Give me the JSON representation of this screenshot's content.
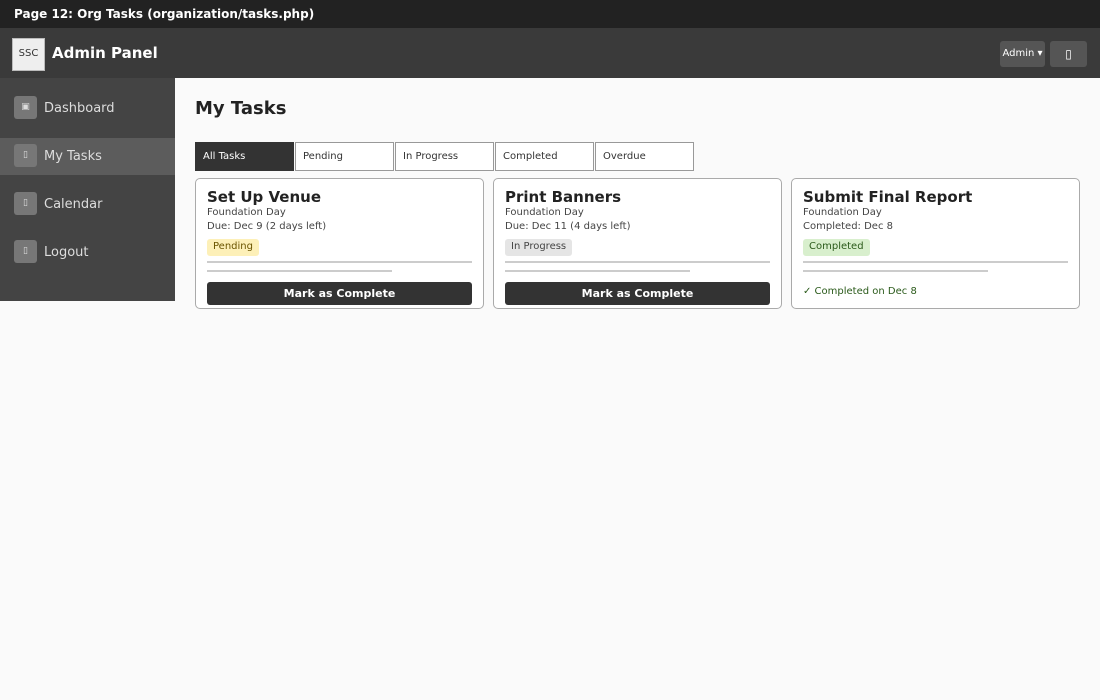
{
  "window": {
    "title": "Page 12: Org Tasks (organization/tasks.php)"
  },
  "header": {
    "logo_text": "SSC",
    "brand": "Admin Panel",
    "admin_label": "Admin ▾",
    "bell_icon": "bell-icon"
  },
  "sidebar": {
    "items": [
      {
        "label": "Dashboard",
        "icon": "dashboard-icon",
        "glyph": "▣",
        "active": false
      },
      {
        "label": "My Tasks",
        "icon": "tasks-icon",
        "glyph": "▯",
        "active": true
      },
      {
        "label": "Calendar",
        "icon": "calendar-icon",
        "glyph": "▯",
        "active": false
      },
      {
        "label": "Logout",
        "icon": "logout-icon",
        "glyph": "▯",
        "active": false
      }
    ]
  },
  "main": {
    "title": "My Tasks",
    "tabs": [
      {
        "label": "All Tasks",
        "active": true
      },
      {
        "label": "Pending",
        "active": false
      },
      {
        "label": "In Progress",
        "active": false
      },
      {
        "label": "Completed",
        "active": false
      },
      {
        "label": "Overdue",
        "active": false
      }
    ],
    "cards": [
      {
        "title": "Set Up Venue",
        "org": "Foundation Day",
        "due": "Due: Dec 9  (2 days left)",
        "status": "Pending",
        "button": "Mark as Complete"
      },
      {
        "title": "Print Banners",
        "org": "Foundation Day",
        "due": "Due: Dec 11  (4 days left)",
        "status": "In Progress",
        "button": "Mark as Complete"
      },
      {
        "title": "Submit Final Report",
        "org": "Foundation Day",
        "due": "Completed: Dec 8",
        "status": "Completed",
        "note": "✓ Completed on Dec 8"
      }
    ]
  },
  "colors": {
    "titlebar": "#222222",
    "topbar": "#3a3a3a",
    "sidebar": "#444444",
    "accent_dark": "#333333",
    "badge_pending": "#fdf0b8",
    "badge_progress": "#e5e5e5",
    "badge_completed": "#d8efcd"
  }
}
